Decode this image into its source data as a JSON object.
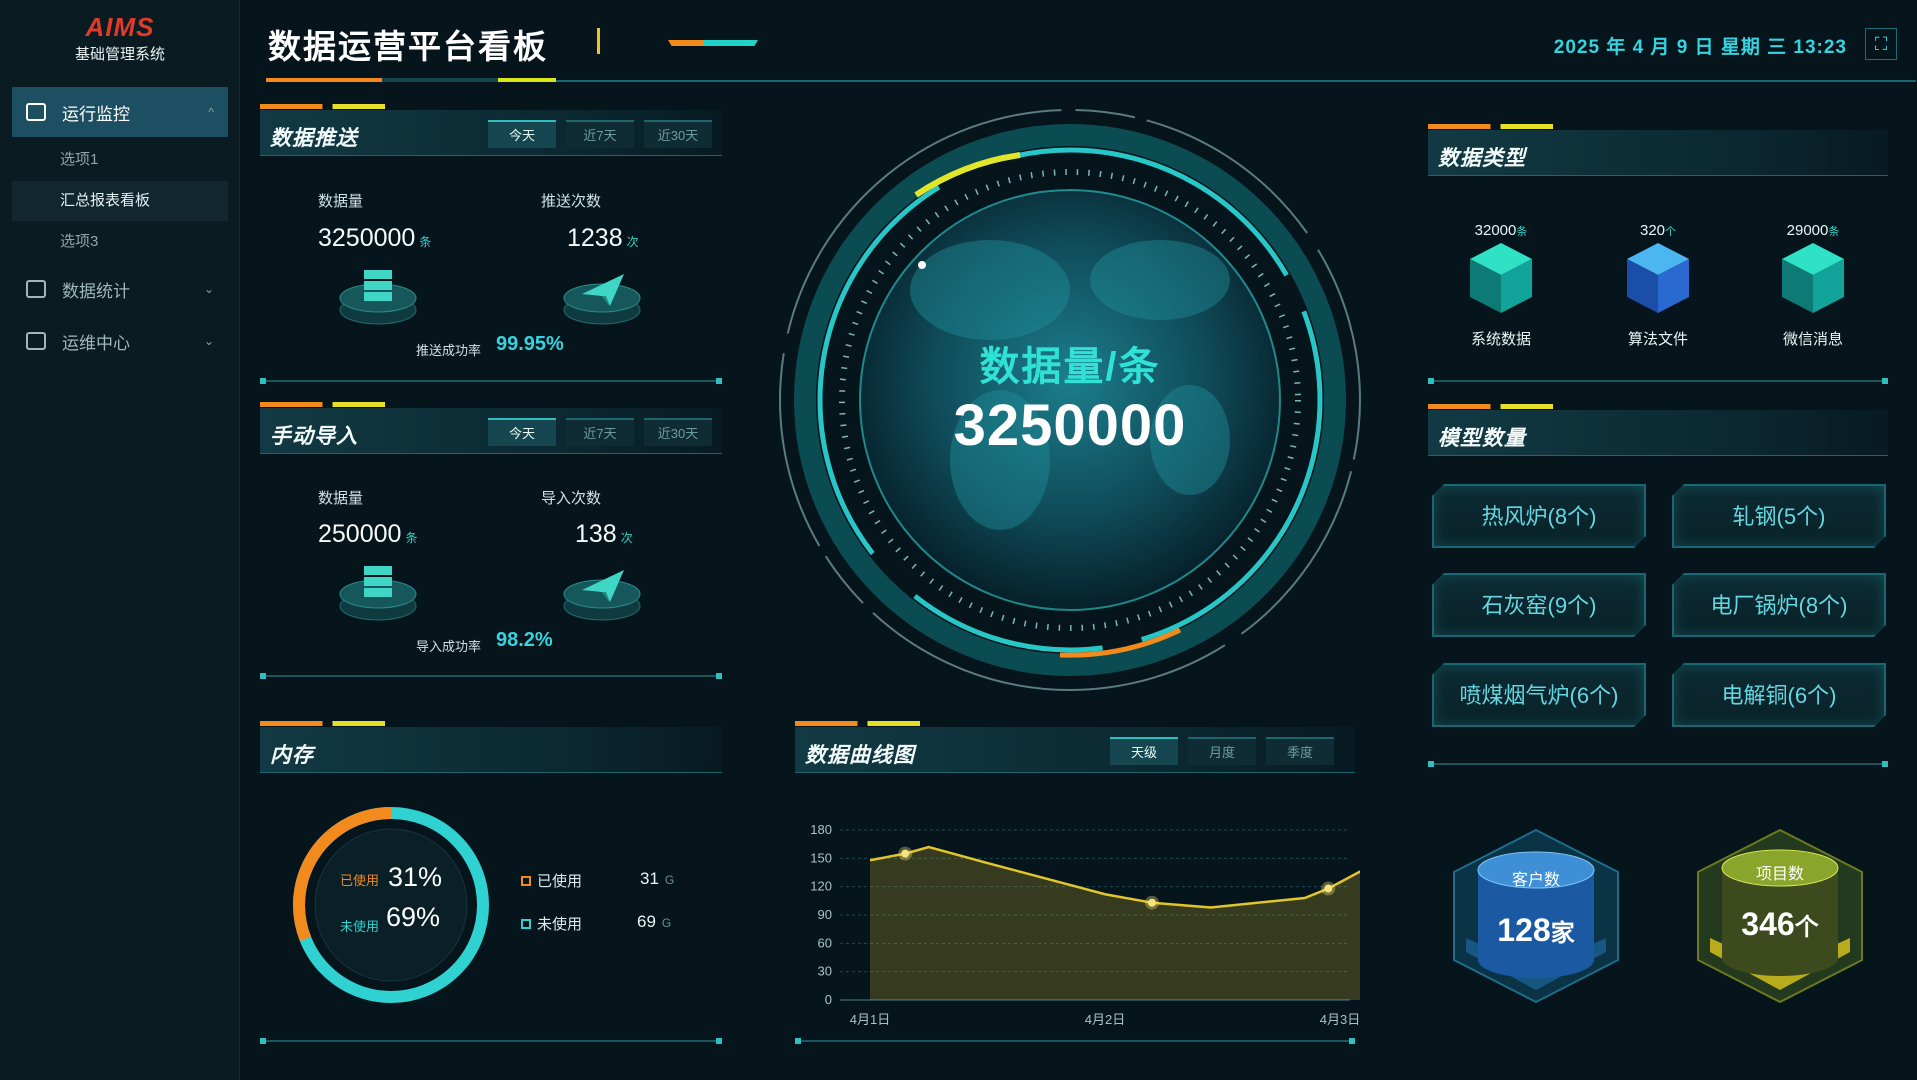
{
  "app": {
    "logo": "AIMS",
    "subtitle": "基础管理系统"
  },
  "sidebar": {
    "items": [
      {
        "label": "运行监控",
        "expanded": true,
        "chevron": "^"
      },
      {
        "label": "数据统计",
        "chevron": "⌄"
      },
      {
        "label": "运维中心",
        "chevron": "⌄"
      }
    ],
    "subitems": [
      "选项1",
      "汇总报表看板",
      "选项3"
    ]
  },
  "header": {
    "title": "数据运营平台看板",
    "datetime": "2025 年 4 月 9 日 星期 三 13:23",
    "fullscreen_icon": "fullscreen-icon"
  },
  "push": {
    "title": "数据推送",
    "tabs": [
      "今天",
      "近7天",
      "近30天"
    ],
    "active_tab": "今天",
    "qty_label": "数据量",
    "qty_value": "3250000",
    "qty_unit": "条",
    "count_label": "推送次数",
    "count_value": "1238",
    "count_unit": "次",
    "rate_label": "推送成功率",
    "rate_value": "99.95%"
  },
  "import": {
    "title": "手动导入",
    "tabs": [
      "今天",
      "近7天",
      "近30天"
    ],
    "active_tab": "今天",
    "qty_label": "数据量",
    "qty_value": "250000",
    "qty_unit": "条",
    "count_label": "导入次数",
    "count_value": "138",
    "count_unit": "次",
    "rate_label": "导入成功率",
    "rate_value": "98.2%"
  },
  "memory": {
    "title": "内存",
    "used_label": "已使用",
    "used_pct": "31%",
    "free_label": "未使用",
    "free_pct": "69%",
    "used_value": "31",
    "free_value": "69",
    "unit": "G",
    "used_fraction": 0.31,
    "colors": {
      "used": "#f28a1e",
      "free": "#2fd1d1"
    }
  },
  "center": {
    "title": "数据量/条",
    "value": "3250000"
  },
  "datatypes": {
    "title": "数据类型",
    "items": [
      {
        "value": "32000",
        "unit": "条",
        "name": "系统数据",
        "color": "#2fe2c6"
      },
      {
        "value": "320",
        "unit": "个",
        "name": "算法文件",
        "color": "#2f8ee6"
      },
      {
        "value": "29000",
        "unit": "条",
        "name": "微信消息",
        "color": "#2fe2c6"
      }
    ]
  },
  "models": {
    "title": "模型数量",
    "items": [
      "热风炉(8个)",
      "轧钢(5个)",
      "石灰窑(9个)",
      "电厂锅炉(8个)",
      "喷煤烟气炉(6个)",
      "电解铜(6个)"
    ]
  },
  "curve": {
    "title": "数据曲线图",
    "tabs": [
      "天级",
      "月度",
      "季度"
    ],
    "active_tab": "天级"
  },
  "chart_data": {
    "type": "area",
    "title": "",
    "x_ticks": [
      "4月1日",
      "4月2日",
      "4月3日"
    ],
    "y_ticks": [
      0,
      30,
      60,
      90,
      120,
      150,
      180
    ],
    "ylim": [
      0,
      180
    ],
    "grid": true,
    "line_color": "#e2c52a",
    "series": [
      {
        "x": [
          0,
          0.15,
          0.25,
          0.5,
          1.0,
          1.2,
          1.45,
          1.85,
          1.95,
          2.1
        ],
        "values": [
          148,
          155,
          162,
          145,
          112,
          103,
          98,
          108,
          118,
          138
        ]
      }
    ]
  },
  "stats": {
    "customers": {
      "label": "客户数",
      "value": "128",
      "unit": "家"
    },
    "projects": {
      "label": "项目数",
      "value": "346",
      "unit": "个"
    }
  }
}
